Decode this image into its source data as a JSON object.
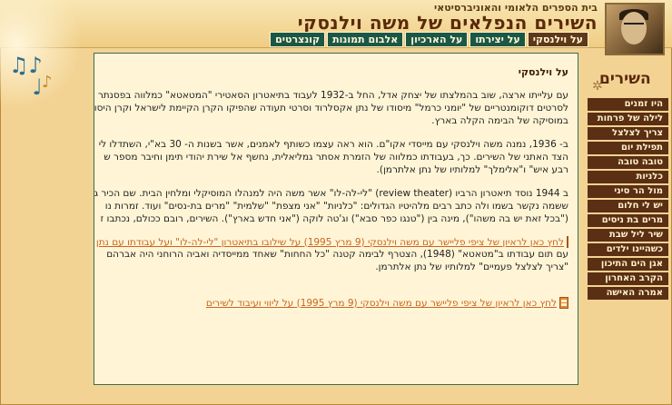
{
  "header": {
    "institution": "בית הספרים הלאומי והאוניברסיטאי",
    "title": "השירים הנפלאים של משה וילנסקי"
  },
  "tabs": [
    {
      "label": "על וילנסקי",
      "active": true
    },
    {
      "label": "על יצירתו",
      "active": false
    },
    {
      "label": "על הארכיון",
      "active": false
    },
    {
      "label": "אלבום תמונות",
      "active": false
    },
    {
      "label": "קונצרטים",
      "active": false
    }
  ],
  "sidebar": {
    "title": "השירים",
    "items": [
      {
        "label": "היו זמנים"
      },
      {
        "label": "לילה של פרחות"
      },
      {
        "label": "צריך לצלצל פעמיים"
      },
      {
        "label": "תפילת יום ההולדת"
      },
      {
        "label": "טובה טובה"
      },
      {
        "label": "כלניות"
      },
      {
        "label": "מול הר סיני"
      },
      {
        "label": "יש לי חלום"
      },
      {
        "label": "מרים בת ניסים"
      },
      {
        "label": "שיר ליל שבת"
      },
      {
        "label": "כשהיינו ילדים"
      },
      {
        "label": "אגן הים התיכון"
      },
      {
        "label": "הקרב האחרון"
      },
      {
        "label": "אמרה האישה"
      }
    ]
  },
  "content": {
    "title": "על וילנסקי",
    "p1": [
      "עם עלייתו ארצה, שוב בהמלצתו של יצחק אדל, החל ב-1932 לעבוד בתיאטרון הסאטירי \"המטאטא\" כמלווה בפסנתר",
      "לסרטים דוקומנטריים של \"יומני כרמל\" מיסודו של נתן אקסלרוד וסרטי תעודה שהפיקו הקרן הקיימת לישראל וקרן היסוד",
      "במוסיקה של הבימה הקלה בארץ."
    ],
    "p2": [
      "ב- 1936, נמנה משה וילנסקי עם מייסדי אקו\"ם. הוא ראה עצמו כשותף לאמנים, אשר בשנות ה- 30 בא\"י, השתדלו לי",
      "הצד האתני של השירים. כך, בעבודתו כמלווה של הזמרת אסתר גמליאלית, נחשף אל שירת יהודי תימן וחיבר מספר ש",
      "רבע איש\" ו\"אלימלך\" למלותיו של נתן אלתרמן)."
    ],
    "p3": [
      "ב 1944 נוסד תיאטרון הרביו (review theater) \"לי-לה-לו\" אשר משה היה למנהלו המוסיקלי ומלחין הבית. שם הכיר ג",
      "ששמה נקשר בשמו ולה כתב רבים מלהיטיו הגדולים: \"כלניות\" \"אני מצפת\" \"שלמית\" \"מרים בת-נסים\" ועוד. זמרות נו",
      "(\"בכל זאת יש בה משהו\"), מינה בין (\"טנגו כפר סבא\") וג'טה לוקה (\"אני חדש בארץ\"). השירים, רובם ככולם, נכתבו ז"
    ],
    "link1": "לחץ כאן לראיון של ציפי פליישר עם משה וילנסקי (9 מרץ 1995) על שילובו בתיאטרון \"לי-לה-לו\" ועל עבודתו עם נתן",
    "p4": [
      "עם תום עבודתו ב\"מטאטא\" (1948), הצטרף לבימה קטנה \"כל החחות\" שאחד ממייסדיה ואביה הרוחני היה אברהם",
      "\"צריך לצלצל פעמיים\" למלותיו של נתן אלתרמן."
    ],
    "link2": "לחץ כאן לראיון של ציפי פליישר עם משה וילנסקי (9 מרץ 1995) על ליווי ועיבוד לשירים"
  }
}
